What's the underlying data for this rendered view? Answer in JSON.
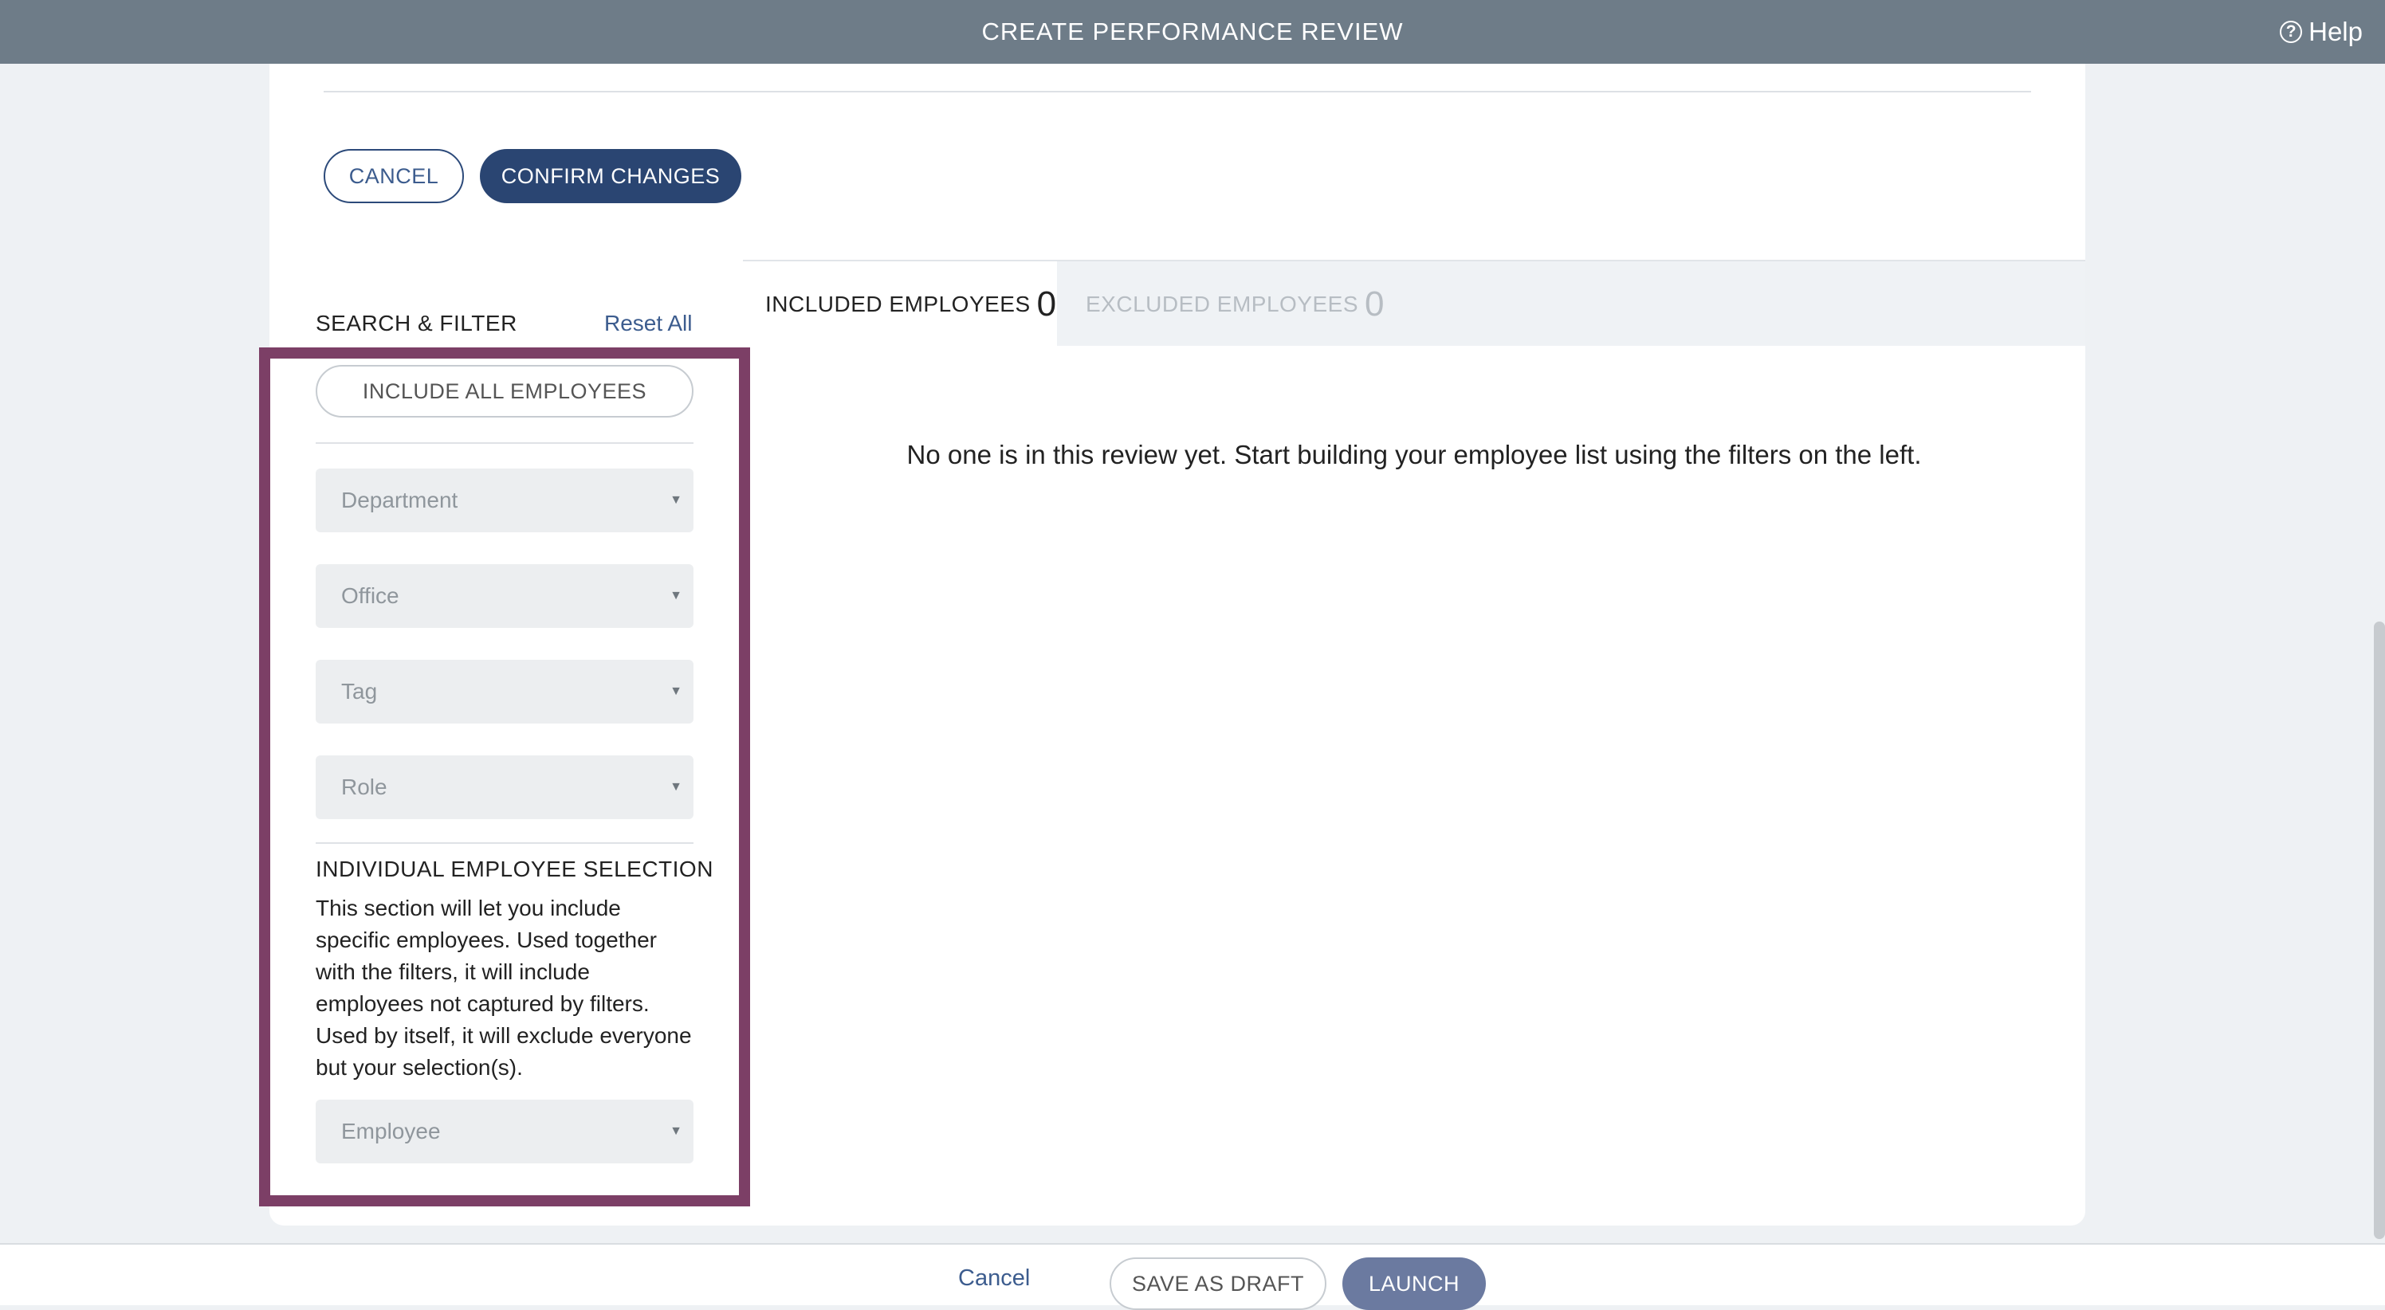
{
  "header": {
    "title": "CREATE PERFORMANCE REVIEW",
    "help_label": "Help",
    "help_icon": "question-circle-icon"
  },
  "actions": {
    "cancel_label": "CANCEL",
    "confirm_label": "CONFIRM CHANGES"
  },
  "filter_panel": {
    "heading": "SEARCH & FILTER",
    "reset_label": "Reset All",
    "include_all_label": "INCLUDE ALL EMPLOYEES",
    "selects": {
      "department": "Department",
      "office": "Office",
      "tag": "Tag",
      "role": "Role",
      "employee": "Employee"
    },
    "individual_selection": {
      "heading": "INDIVIDUAL EMPLOYEE SELECTION",
      "description": "This section will let you include specific employees. Used together with the filters, it will include employees not captured by filters. Used by itself, it will exclude everyone but your selection(s)."
    }
  },
  "tabs": {
    "included": {
      "label": "INCLUDED EMPLOYEES",
      "count": "0"
    },
    "excluded": {
      "label": "EXCLUDED EMPLOYEES",
      "count": "0"
    }
  },
  "empty_state": "No one is in this review yet. Start building your employee list using the filters on the left.",
  "footer": {
    "cancel_label": "Cancel",
    "save_draft_label": "SAVE AS DRAFT",
    "launch_label": "LAUNCH"
  },
  "colors": {
    "header_bg": "#6e7c88",
    "primary": "#2a4572",
    "highlight_border": "#7c3f66",
    "launch_bg": "#6b7aa0"
  }
}
